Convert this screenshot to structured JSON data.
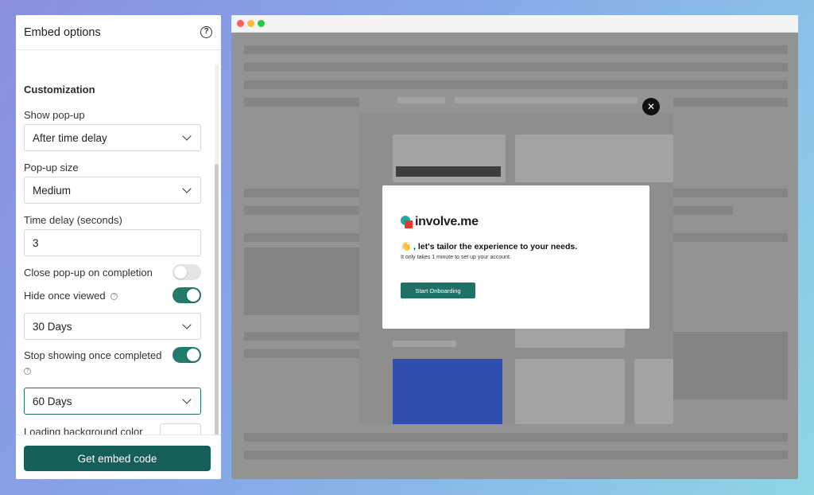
{
  "panel": {
    "title": "Embed options",
    "section_title": "Customization",
    "show_popup": {
      "label": "Show pop-up",
      "value": "After time delay"
    },
    "popup_size": {
      "label": "Pop-up size",
      "value": "Medium"
    },
    "time_delay": {
      "label": "Time delay (seconds)",
      "value": "3"
    },
    "close_on_completion": {
      "label": "Close pop-up on completion",
      "enabled": false
    },
    "hide_once_viewed": {
      "label": "Hide once viewed",
      "enabled": true,
      "duration": "30 Days"
    },
    "stop_showing": {
      "label": "Stop showing once completed",
      "enabled": true,
      "duration": "60 Days"
    },
    "loading_bg": {
      "label": "Loading background color",
      "value": "#ffffff"
    },
    "embed_button": "Get embed code"
  },
  "preview": {
    "brand": "involve.me",
    "headline": "👋 , let's tailor the experience to your needs.",
    "subtext": "It only takes 1 minute to set up your account.",
    "cta": "Start Onboarding",
    "close_symbol": "✕",
    "window_dots": [
      "#ff5f57",
      "#febc2e",
      "#28c840"
    ]
  },
  "colors": {
    "accent": "#165f58",
    "toggle_on": "#217a6c"
  }
}
